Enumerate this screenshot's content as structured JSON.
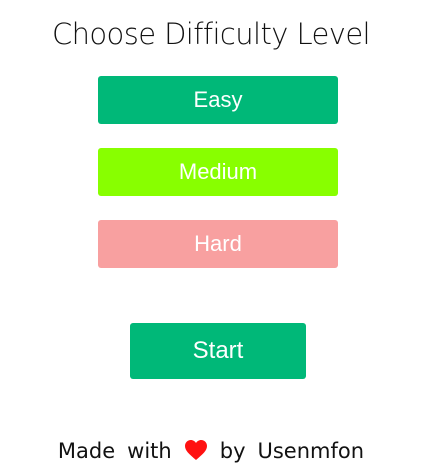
{
  "page": {
    "title": "Choose Difficulty Level"
  },
  "levels": [
    {
      "label": "Easy",
      "color": "#00b878"
    },
    {
      "label": "Medium",
      "color": "#88ff00"
    },
    {
      "label": "Hard",
      "color": "#f8a0a0"
    }
  ],
  "start_button": {
    "label": "Start",
    "color": "#00b878"
  },
  "footer": {
    "made": "Made",
    "with": "with",
    "heart_icon": "heart-icon",
    "heart_color": "#ff1111",
    "by": "by",
    "author": "Usenmfon"
  }
}
